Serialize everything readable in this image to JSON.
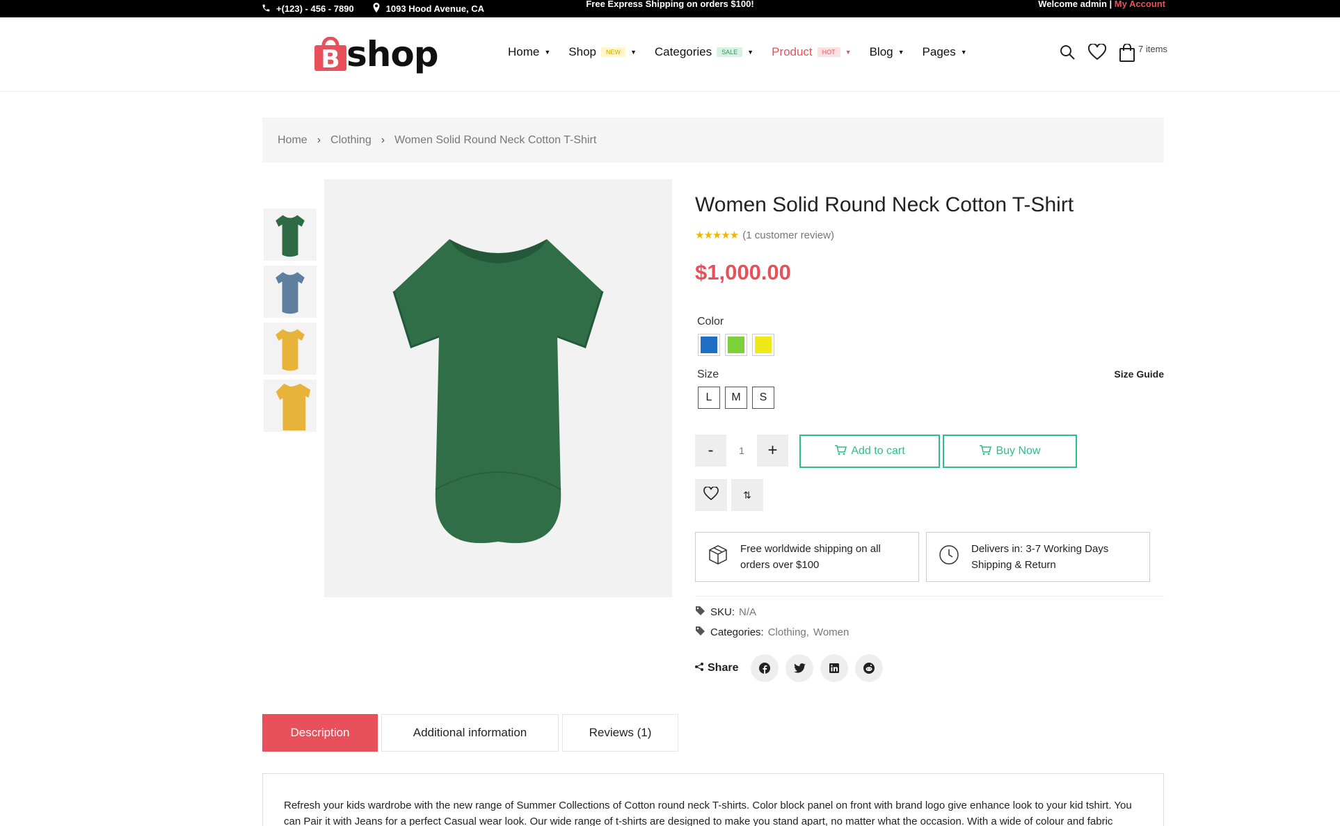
{
  "topbar": {
    "phone": "+(123) - 456 - 7890",
    "address": "1093 Hood Avenue, CA",
    "promo": "Free Express Shipping on orders $100!",
    "welcome": "Welcome admin | ",
    "account": "My Account"
  },
  "logo": {
    "text": "shop",
    "letter": "B"
  },
  "nav": [
    {
      "label": "Home",
      "badge": ""
    },
    {
      "label": "Shop",
      "badge": "NEW"
    },
    {
      "label": "Categories",
      "badge": "SALE"
    },
    {
      "label": "Product",
      "badge": "HOT"
    },
    {
      "label": "Blog",
      "badge": ""
    },
    {
      "label": "Pages",
      "badge": ""
    }
  ],
  "cart": {
    "count_label": "7 items"
  },
  "breadcrumb": [
    "Home",
    "Clothing",
    "Women Solid Round Neck Cotton T-Shirt"
  ],
  "product": {
    "title": "Women Solid Round Neck Cotton T-Shirt",
    "stars": "★★★★★",
    "rating": 5,
    "review_text": "(1 customer review)",
    "price": "$1,000.00",
    "color_label": "Color",
    "colors": [
      "#1f6fc4",
      "#7cd13a",
      "#f0e91a"
    ],
    "size_label": "Size",
    "size_guide": "Size Guide",
    "sizes": [
      "L",
      "M",
      "S"
    ],
    "qty_minus": "-",
    "qty_plus": "+",
    "quantity": "1",
    "add_to_cart": "Add to cart",
    "buy_now": "Buy Now",
    "compare_icon": "⇅",
    "feature_shipping": "Free worldwide shipping on all orders over $100",
    "feature_delivery": "Delivers in: 3-7 Working Days Shipping & Return",
    "sku_label": "SKU:",
    "sku_value": "N/A",
    "categories_label": "Categories:",
    "categories": [
      "Clothing",
      "Women"
    ],
    "categories_sep": ",",
    "share_label": "Share",
    "socials": [
      "facebook-icon",
      "twitter-icon",
      "linkedin-icon",
      "reddit-icon"
    ]
  },
  "thumb_colors": [
    "#2e6b45",
    "#5f7f9f",
    "#e8b33b",
    "#e8b33b"
  ],
  "main_image_color": "#2f6e47",
  "tabs": [
    "Description",
    "Additional information",
    "Reviews (1)"
  ],
  "description": "Refresh your kids wardrobe with the new range of Summer Collections of Cotton round neck T-shirts. Color block panel on front with brand logo give enhance look to your kid tshirt. You can Pair it with Jeans for a perfect Casual wear look. Our wide range of t-shirts are designed to make you stand apart, no matter what the occasion. With a wide of colour and fabric options,",
  "colors": {
    "accent": "#e8515b",
    "green": "#2ebd8a",
    "new_badge_bg": "#fff6c9",
    "new_badge_fg": "#d2a800",
    "sale_badge_bg": "#d7f1e3",
    "sale_badge_fg": "#2a9a62",
    "hot_badge_bg": "#fde0e2",
    "hot_badge_fg": "#e8515b"
  }
}
